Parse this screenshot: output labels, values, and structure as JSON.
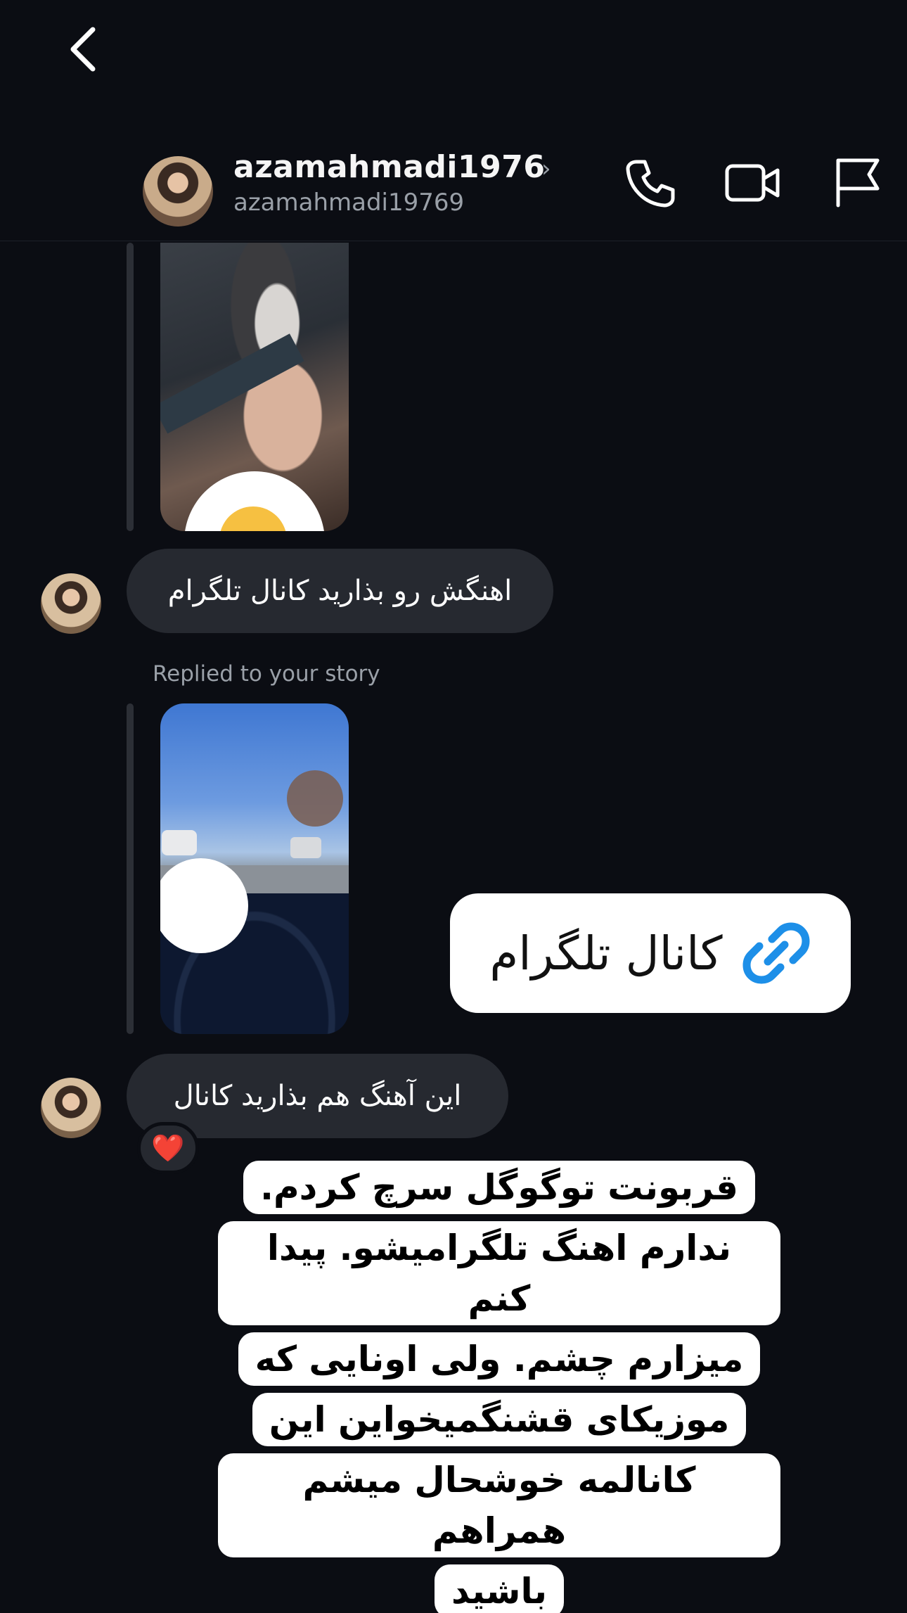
{
  "header": {
    "username": "azamahmadi1976",
    "handle": "azamahmadi19769",
    "chevron": "›",
    "icons": [
      "back-icon",
      "phone-icon",
      "video-icon",
      "flag-icon"
    ]
  },
  "thread": {
    "message1": "اهنگش رو بذارید کانال تلگرام",
    "reply_label": "Replied to your story",
    "story_reaction_emoji": "😍",
    "message2": "این آهنگ هم بذارید کانال",
    "message2_reaction": "❤️"
  },
  "link_sticker": {
    "label": "کانال تلگرام"
  },
  "caption": {
    "lines": [
      "قربونت توگوگل سرچ کردم.",
      "ندارم  اهنگ تلگرامیشو. پیدا کنم",
      "میزارم چشم. ولی اونایی که",
      "موزیکای قشنگمیخواین این",
      "کانالمه خوشحال میشم همراهم",
      "باشید"
    ]
  },
  "colors": {
    "background": "#0b0d13",
    "bubble": "#262930",
    "secondary_text": "#9aa0a8",
    "link_icon": "#1d8fe8"
  }
}
